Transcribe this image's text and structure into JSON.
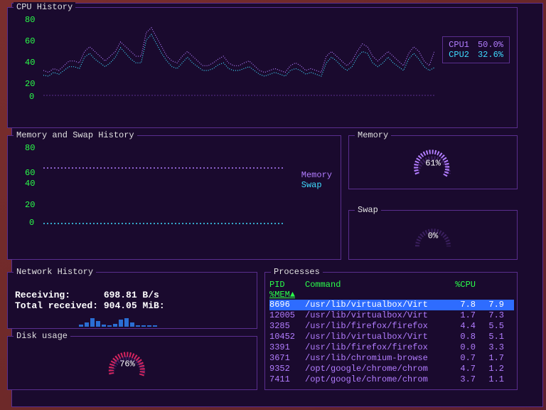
{
  "cpu_history": {
    "title": "CPU History",
    "yticks": [
      "80",
      "60",
      "40",
      "20",
      "0"
    ],
    "legend": {
      "cpu1_label": "CPU1",
      "cpu1_value": "50.0%",
      "cpu2_label": "CPU2",
      "cpu2_value": "32.6%"
    }
  },
  "memswap_history": {
    "title": "Memory and Swap History",
    "yticks": [
      "80",
      "60",
      "40",
      "20",
      "0"
    ],
    "legend": {
      "memory": "Memory",
      "swap": "Swap"
    }
  },
  "memory_gauge": {
    "title": "Memory",
    "value": "61%"
  },
  "swap_gauge": {
    "title": "Swap",
    "value": "0%"
  },
  "network": {
    "title": "Network History",
    "receiving_label": "Receiving:",
    "receiving_value": "698.81  B/s",
    "total_label": "Total received:",
    "total_value": "904.05 MiB:"
  },
  "disk": {
    "title": "Disk usage",
    "value": "76%"
  },
  "processes": {
    "title": "Processes",
    "headers": {
      "pid": "PID",
      "command": "Command",
      "cpu": "%CPU",
      "mem": "%MEM",
      "sort_arrow": "▲"
    },
    "rows": [
      {
        "pid": "8696",
        "cmd": "/usr/lib/virtualbox/Virt",
        "cpu": "7.8",
        "mem": "7.9",
        "selected": true
      },
      {
        "pid": "12005",
        "cmd": "/usr/lib/virtualbox/Virt",
        "cpu": "1.7",
        "mem": "7.3"
      },
      {
        "pid": "3285",
        "cmd": "/usr/lib/firefox/firefox",
        "cpu": "4.4",
        "mem": "5.5"
      },
      {
        "pid": "10452",
        "cmd": "/usr/lib/virtualbox/Virt",
        "cpu": "0.8",
        "mem": "5.1"
      },
      {
        "pid": "3391",
        "cmd": "/usr/lib/firefox/firefox",
        "cpu": "0.0",
        "mem": "3.3"
      },
      {
        "pid": "3671",
        "cmd": "/usr/lib/chromium-browse",
        "cpu": "0.7",
        "mem": "1.7"
      },
      {
        "pid": "9352",
        "cmd": "/opt/google/chrome/chrom",
        "cpu": "4.7",
        "mem": "1.2"
      },
      {
        "pid": "7411",
        "cmd": "/opt/google/chrome/chrom",
        "cpu": "3.7",
        "mem": "1.1"
      }
    ]
  },
  "chart_data": {
    "cpu_history": {
      "type": "line",
      "ylim": [
        0,
        90
      ],
      "yticks": [
        0,
        20,
        40,
        60,
        80
      ],
      "series": [
        {
          "name": "CPU1",
          "color": "#b27dff",
          "values": [
            30,
            28,
            32,
            30,
            35,
            40,
            40,
            38,
            50,
            55,
            50,
            45,
            40,
            45,
            50,
            60,
            55,
            50,
            45,
            45,
            70,
            75,
            65,
            55,
            45,
            40,
            38,
            45,
            50,
            45,
            40,
            35,
            35,
            38,
            42,
            45,
            38,
            35,
            35,
            38,
            40,
            35,
            30,
            28,
            30,
            32,
            30,
            28,
            35,
            38,
            35,
            30,
            32,
            30,
            28,
            45,
            50,
            45,
            40,
            35,
            40,
            50,
            58,
            55,
            45,
            40,
            45,
            50,
            45,
            40,
            35,
            48,
            55,
            50,
            40,
            35,
            50
          ]
        },
        {
          "name": "CPU2",
          "color": "#3edcff",
          "values": [
            25,
            24,
            28,
            26,
            30,
            34,
            34,
            32,
            44,
            48,
            42,
            38,
            34,
            38,
            44,
            54,
            48,
            42,
            38,
            38,
            62,
            68,
            58,
            48,
            40,
            34,
            32,
            38,
            44,
            38,
            34,
            30,
            30,
            32,
            36,
            38,
            32,
            30,
            30,
            32,
            34,
            30,
            26,
            24,
            26,
            28,
            26,
            24,
            30,
            32,
            30,
            26,
            28,
            26,
            24,
            38,
            44,
            40,
            34,
            30,
            34,
            44,
            50,
            48,
            38,
            34,
            38,
            44,
            38,
            34,
            30,
            42,
            48,
            42,
            34,
            30,
            33
          ]
        }
      ]
    },
    "memswap_history": {
      "type": "line",
      "ylim": [
        0,
        90
      ],
      "yticks": [
        0,
        20,
        40,
        60,
        80
      ],
      "series": [
        {
          "name": "Memory",
          "color": "#b27dff",
          "value_constant": 61
        },
        {
          "name": "Swap",
          "color": "#3edcff",
          "value_constant": 0
        }
      ]
    },
    "network_bars": {
      "type": "bar",
      "values": [
        3,
        6,
        12,
        8,
        3,
        2,
        4,
        10,
        12,
        6,
        2,
        2,
        2,
        2
      ]
    },
    "memory_gauge": {
      "type": "gauge",
      "percent": 61,
      "color": "#b27dff"
    },
    "swap_gauge": {
      "type": "gauge",
      "percent": 0,
      "color": "#b27dff"
    },
    "disk_gauge": {
      "type": "gauge",
      "percent": 76,
      "color": "#d4245e"
    }
  }
}
